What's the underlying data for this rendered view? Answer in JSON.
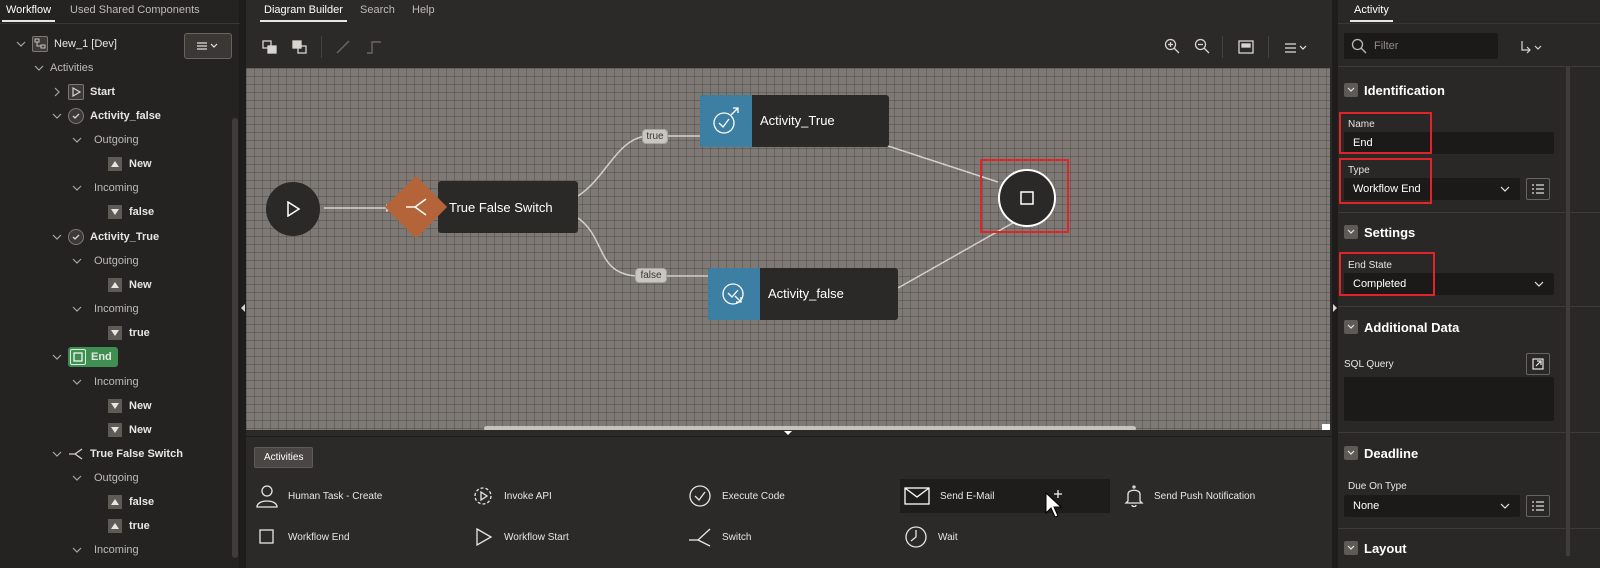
{
  "left": {
    "tabs": [
      "Workflow",
      "Used Shared Components"
    ],
    "tree": {
      "root": "New_1 [Dev]",
      "activities": "Activities",
      "start": "Start",
      "activity_false": "Activity_false",
      "outgoing": "Outgoing",
      "incoming": "Incoming",
      "new": "New",
      "false": "false",
      "true": "true",
      "activity_true": "Activity_True",
      "end": "End",
      "switch": "True False Switch"
    }
  },
  "center": {
    "tabs": [
      "Diagram Builder",
      "Search",
      "Help"
    ],
    "diagram": {
      "switch_label": "True False Switch",
      "activity_true": "Activity_True",
      "activity_false": "Activity_false",
      "true_label": "true",
      "false_label": "false"
    },
    "palette": {
      "tab": "Activities",
      "items": [
        "Human Task - Create",
        "Invoke API",
        "Execute Code",
        "Send E-Mail",
        "Send Push Notification",
        "Workflow End",
        "Workflow Start",
        "Switch",
        "Wait"
      ]
    }
  },
  "right": {
    "tab": "Activity",
    "filter_placeholder": "Filter",
    "identification": "Identification",
    "name_label": "Name",
    "name_value": "End",
    "type_label": "Type",
    "type_value": "Workflow End",
    "settings": "Settings",
    "end_state_label": "End State",
    "end_state_value": "Completed",
    "additional_data": "Additional Data",
    "sql_query_label": "SQL Query",
    "deadline": "Deadline",
    "due_on_type_label": "Due On Type",
    "due_on_type_value": "None",
    "layout": "Layout"
  },
  "colors": {
    "highlight_red": "#e0242a",
    "end_node_green": "#3f8f52",
    "activity_blue": "#3d7fa3",
    "switch_orange": "#b5643a"
  }
}
